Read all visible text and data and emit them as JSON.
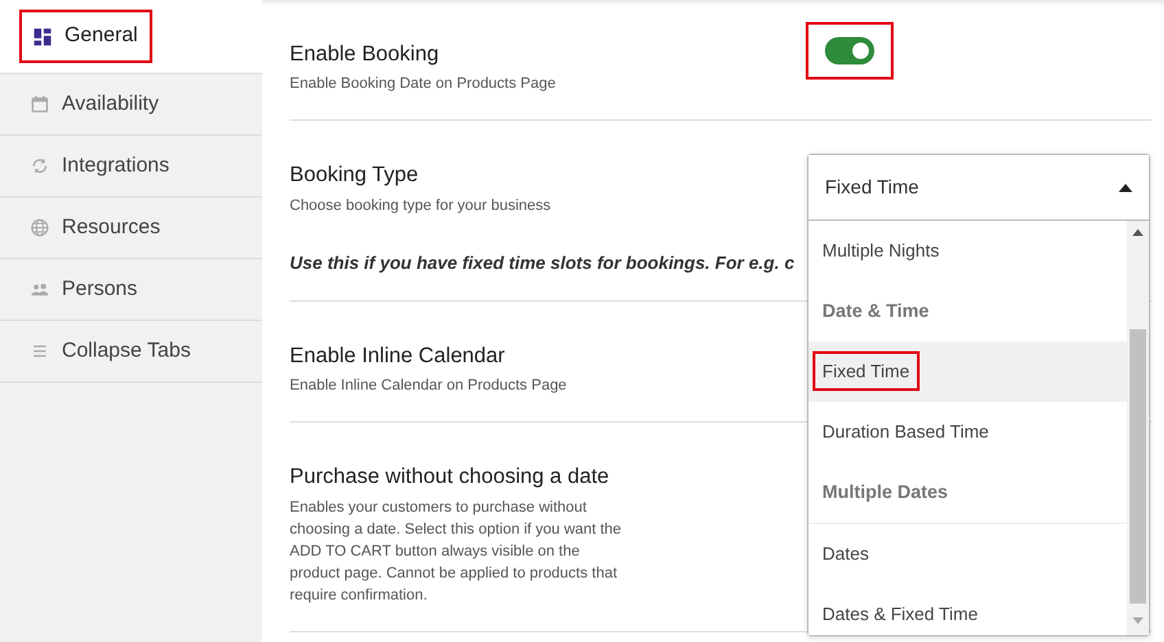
{
  "sidebar": {
    "items": [
      {
        "label": "General",
        "selected": true,
        "highlighted": true
      },
      {
        "label": "Availability",
        "selected": false,
        "highlighted": false
      },
      {
        "label": "Integrations",
        "selected": false,
        "highlighted": false
      },
      {
        "label": "Resources",
        "selected": false,
        "highlighted": false
      },
      {
        "label": "Persons",
        "selected": false,
        "highlighted": false
      },
      {
        "label": "Collapse Tabs",
        "selected": false,
        "highlighted": false
      }
    ]
  },
  "settings": [
    {
      "kind": "toggle",
      "title": "Enable Booking",
      "description": "Enable Booking Date on Products Page",
      "on": true,
      "highlighted": true
    },
    {
      "kind": "select",
      "title": "Booking Type",
      "description": "Choose booking type for your business",
      "note": "Use this if you have fixed time slots for bookings. For e.g. c"
    },
    {
      "kind": "plain",
      "title": "Enable Inline Calendar",
      "description": "Enable Inline Calendar on Products Page"
    },
    {
      "kind": "plain",
      "title": "Purchase without choosing a date",
      "description": "Enables your customers to purchase without choosing a date. Select this option if you want the ADD TO CART button always visible on the product page. Cannot be applied to products that require confirmation."
    }
  ],
  "dropdown": {
    "value": "Fixed Time",
    "expanded": true,
    "options": [
      {
        "kind": "option",
        "label": "Multiple Nights",
        "selected": false,
        "highlighted": false
      },
      {
        "kind": "group",
        "label": "Date & Time"
      },
      {
        "kind": "option",
        "label": "Fixed Time",
        "selected": true,
        "highlighted": true
      },
      {
        "kind": "option",
        "label": "Duration Based Time",
        "selected": false,
        "highlighted": false
      },
      {
        "kind": "group",
        "label": "Multiple Dates"
      },
      {
        "kind": "option",
        "label": "Dates",
        "selected": false,
        "highlighted": false
      },
      {
        "kind": "option",
        "label": "Dates & Fixed Time",
        "selected": false,
        "highlighted": false
      }
    ]
  }
}
